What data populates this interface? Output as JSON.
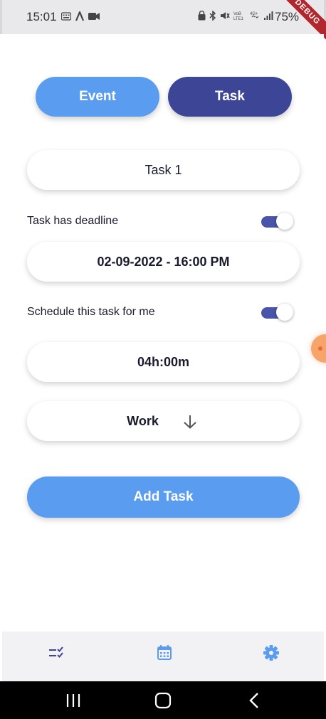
{
  "status_bar": {
    "time": "15:01",
    "battery": "75%",
    "left_icons": [
      "keyboard-icon",
      "a-icon",
      "camera-icon"
    ],
    "right_icons": [
      "vpn-icon",
      "bluetooth-icon",
      "mute-icon",
      "volte-icon",
      "4g-icon",
      "signal-icon"
    ]
  },
  "debug_banner": "DEBUG",
  "mode_toggle": {
    "event_label": "Event",
    "task_label": "Task",
    "selected": "Task"
  },
  "task_name": "Task 1",
  "deadline": {
    "label": "Task has deadline",
    "enabled": true,
    "value": "02-09-2022 - 16:00 PM"
  },
  "schedule": {
    "label": "Schedule this task for me",
    "enabled": true
  },
  "duration": "04h:00m",
  "category": {
    "value": "Work"
  },
  "add_button_label": "Add Task",
  "bottom_nav": {
    "items": [
      "tasks-list-icon",
      "calendar-icon",
      "settings-icon"
    ],
    "active": "settings-icon"
  },
  "colors": {
    "primary_blue": "#5a9cf0",
    "indigo": "#3d4696",
    "toggle_track": "#4a54a8",
    "nav_icon": "#5a9cf0"
  }
}
